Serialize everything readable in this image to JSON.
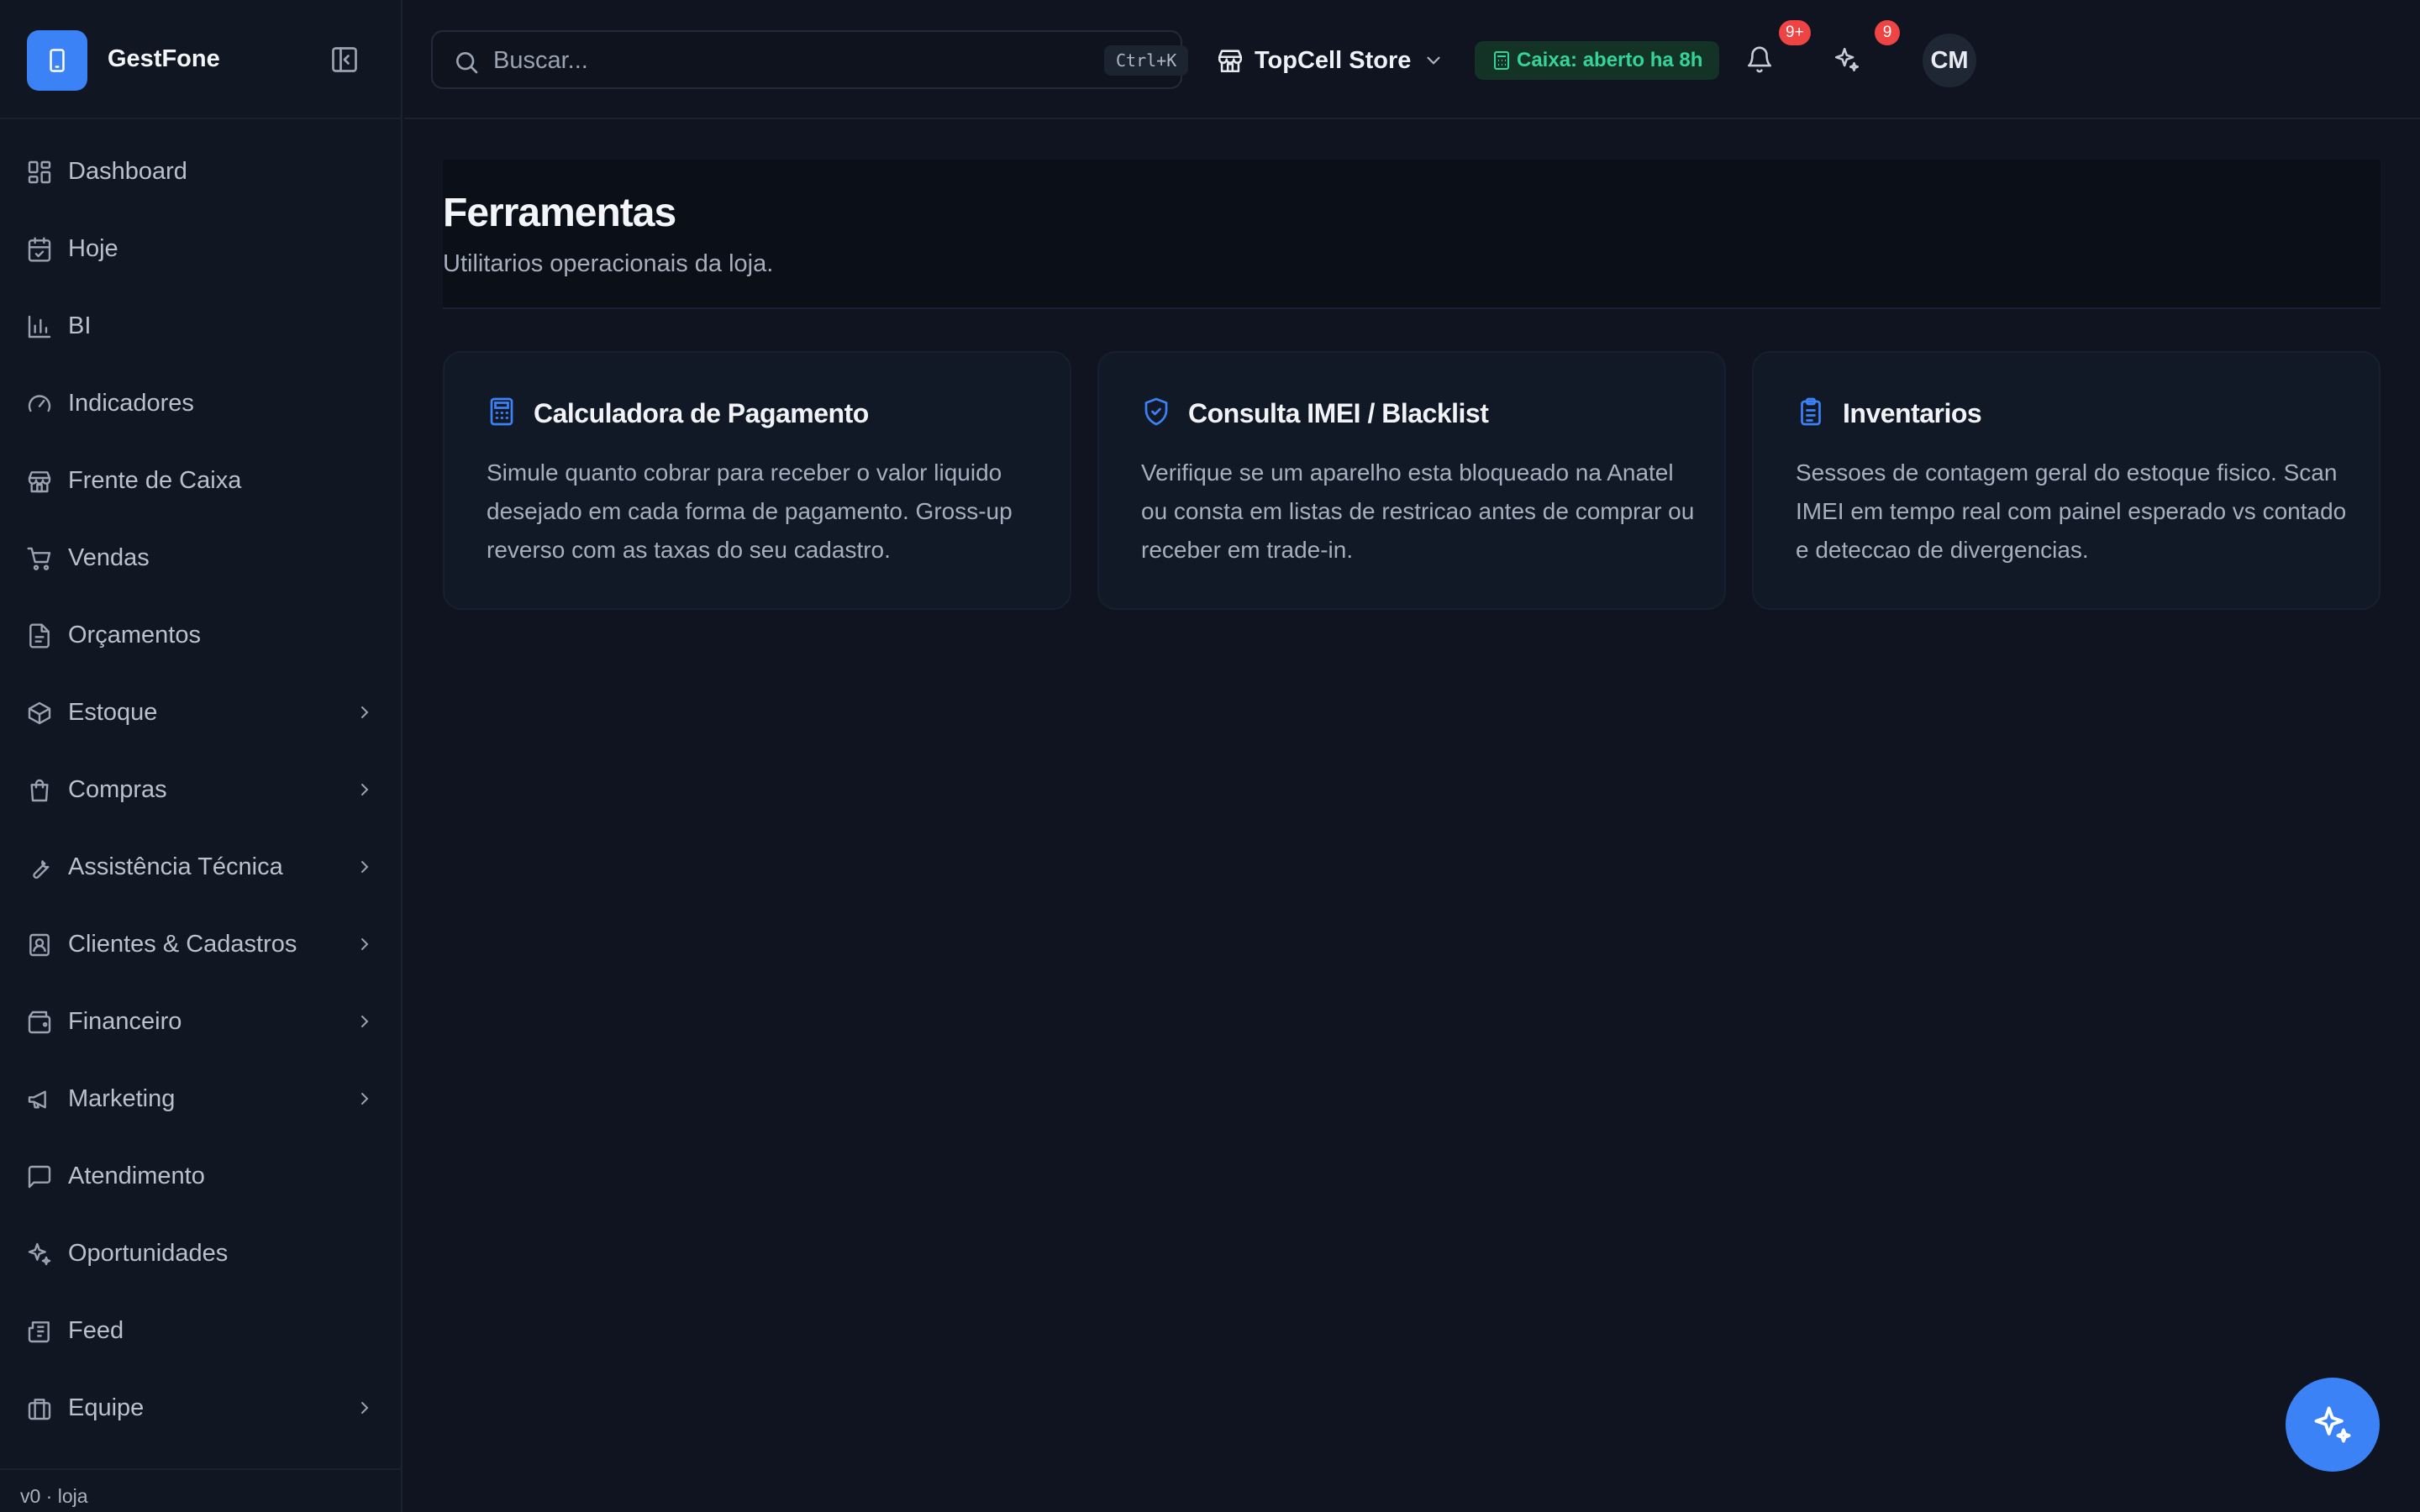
{
  "brand": {
    "name": "GestFone"
  },
  "sidebar": {
    "items": [
      {
        "label": "Dashboard",
        "icon": "dashboard-icon",
        "has_children": false
      },
      {
        "label": "Hoje",
        "icon": "calendar-check-icon",
        "has_children": false
      },
      {
        "label": "BI",
        "icon": "bar-chart-icon",
        "has_children": false
      },
      {
        "label": "Indicadores",
        "icon": "gauge-icon",
        "has_children": false
      },
      {
        "label": "Frente de Caixa",
        "icon": "store-icon",
        "has_children": false
      },
      {
        "label": "Vendas",
        "icon": "cart-icon",
        "has_children": false
      },
      {
        "label": "Orçamentos",
        "icon": "document-icon",
        "has_children": false
      },
      {
        "label": "Estoque",
        "icon": "package-icon",
        "has_children": true
      },
      {
        "label": "Compras",
        "icon": "shopping-bag-icon",
        "has_children": true
      },
      {
        "label": "Assistência Técnica",
        "icon": "wrench-icon",
        "has_children": true
      },
      {
        "label": "Clientes & Cadastros",
        "icon": "contact-icon",
        "has_children": true
      },
      {
        "label": "Financeiro",
        "icon": "wallet-icon",
        "has_children": true
      },
      {
        "label": "Marketing",
        "icon": "megaphone-icon",
        "has_children": true
      },
      {
        "label": "Atendimento",
        "icon": "message-square-icon",
        "has_children": false
      },
      {
        "label": "Oportunidades",
        "icon": "sparkles-icon",
        "has_children": false
      },
      {
        "label": "Feed",
        "icon": "newspaper-icon",
        "has_children": false
      },
      {
        "label": "Equipe",
        "icon": "briefcase-icon",
        "has_children": true
      }
    ],
    "version": "v0 · loja"
  },
  "topbar": {
    "search": {
      "placeholder": "Buscar...",
      "value": "",
      "shortcut": "Ctrl+K"
    },
    "store": {
      "name": "TopCell Store"
    },
    "cash_status": "Caixa: aberto ha 8h",
    "notifications_badge": "9+",
    "insights_badge": "9",
    "avatar_initials": "CM"
  },
  "page": {
    "title": "Ferramentas",
    "subtitle": "Utilitarios operacionais da loja."
  },
  "cards": [
    {
      "title": "Calculadora de Pagamento",
      "icon": "calculator-icon",
      "description": "Simule quanto cobrar para receber o valor liquido desejado em cada forma de pagamento. Gross-up reverso com as taxas do seu cadastro."
    },
    {
      "title": "Consulta IMEI / Blacklist",
      "icon": "shield-check-icon",
      "description": "Verifique se um aparelho esta bloqueado na Anatel ou consta em listas de restricao antes de comprar ou receber em trade-in."
    },
    {
      "title": "Inventarios",
      "icon": "clipboard-list-icon",
      "description": "Sessoes de contagem geral do estoque fisico. Scan IMEI em tempo real com painel esperado vs contado e deteccao de divergencias."
    }
  ],
  "colors": {
    "accent": "#3b82f6",
    "background": "#0f1420",
    "sidebar": "#111722",
    "success": "#34d399",
    "danger": "#ef4444"
  }
}
